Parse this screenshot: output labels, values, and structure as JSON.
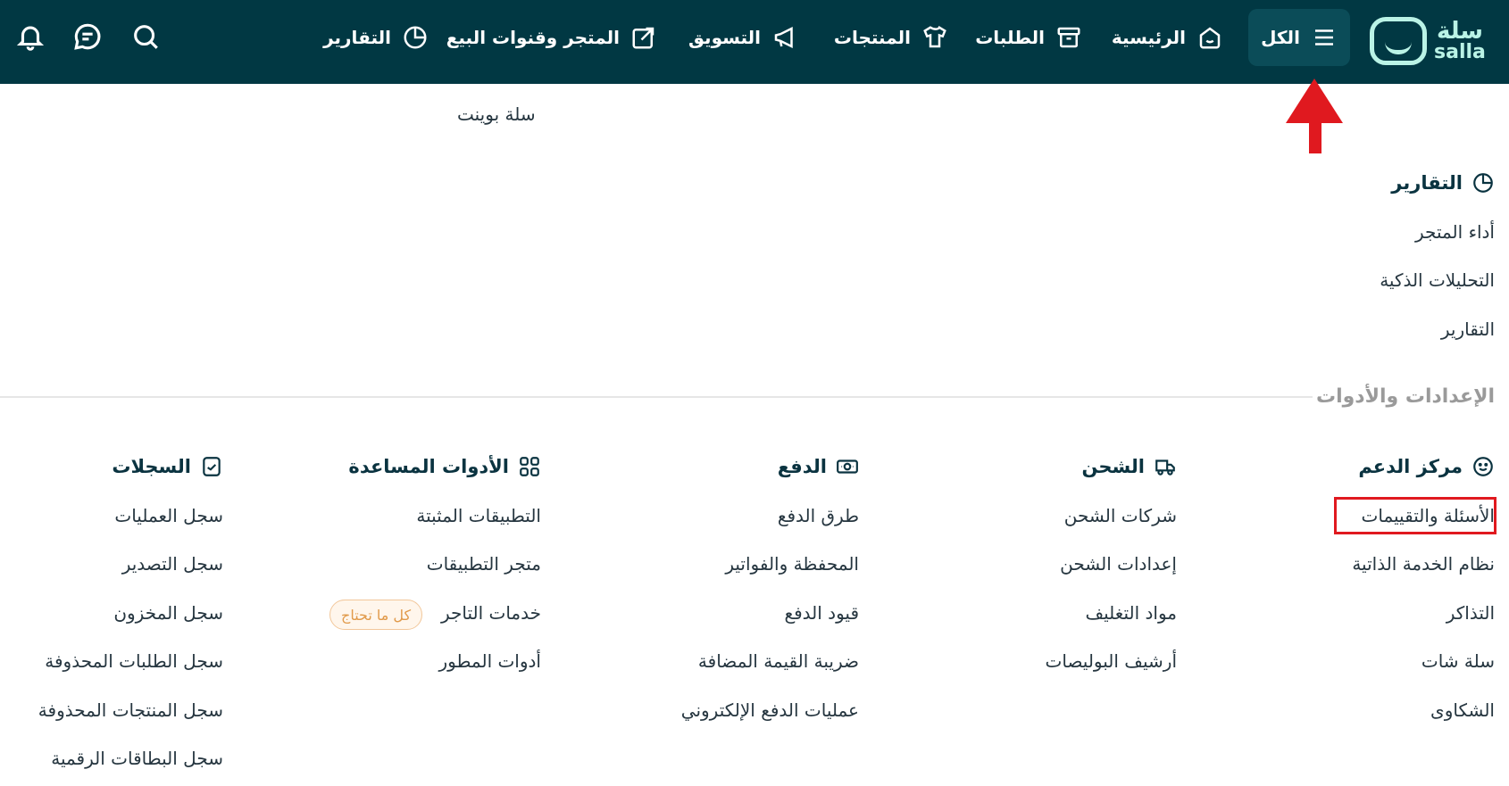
{
  "brand": {
    "name_ar": "سلة",
    "name_en": "salla"
  },
  "nav": {
    "all": "الكل",
    "home": "الرئيسية",
    "orders": "الطلبات",
    "products": "المنتجات",
    "marketing": "التسويق",
    "store_channels": "المتجر وقنوات البيع",
    "reports": "التقارير"
  },
  "top_section": {
    "salla_point": "سلة بوينت"
  },
  "reports_group": {
    "title": "التقارير",
    "items": [
      "أداء المتجر",
      "التحليلات الذكية",
      "التقارير"
    ]
  },
  "settings_section": {
    "title": "الإعدادات والأدوات"
  },
  "columns": {
    "support": {
      "title": "مركز الدعم",
      "items": [
        "الأسئلة والتقييمات",
        "نظام الخدمة الذاتية",
        "التذاكر",
        "سلة شات",
        "الشكاوى"
      ]
    },
    "shipping": {
      "title": "الشحن",
      "items": [
        "شركات الشحن",
        "إعدادات الشحن",
        "مواد التغليف",
        "أرشيف البوليصات"
      ]
    },
    "payment": {
      "title": "الدفع",
      "items": [
        "طرق الدفع",
        "المحفظة والفواتير",
        "قيود الدفع",
        "ضريبة القيمة المضافة",
        "عمليات الدفع الإلكتروني"
      ]
    },
    "tools": {
      "title": "الأدوات المساعدة",
      "items": [
        "التطبيقات المثبتة",
        "متجر التطبيقات",
        "خدمات التاجر",
        "أدوات المطور"
      ],
      "badge": "كل ما تحتاج"
    },
    "logs": {
      "title": "السجلات",
      "items": [
        "سجل العمليات",
        "سجل التصدير",
        "سجل المخزون",
        "سجل الطلبات المحذوفة",
        "سجل المنتجات المحذوفة",
        "سجل البطاقات الرقمية"
      ]
    }
  },
  "colors": {
    "topbar": "#013843",
    "accent": "#baf3e6",
    "highlight": "#e0191f"
  },
  "icons": {
    "menu": "hamburger-icon",
    "home": "home-icon",
    "orders": "box-icon",
    "products": "tshirt-icon",
    "marketing": "megaphone-icon",
    "store": "share-icon",
    "reports": "pie-chart-icon",
    "search": "search-icon",
    "chat": "chat-icon",
    "bell": "bell-icon"
  }
}
